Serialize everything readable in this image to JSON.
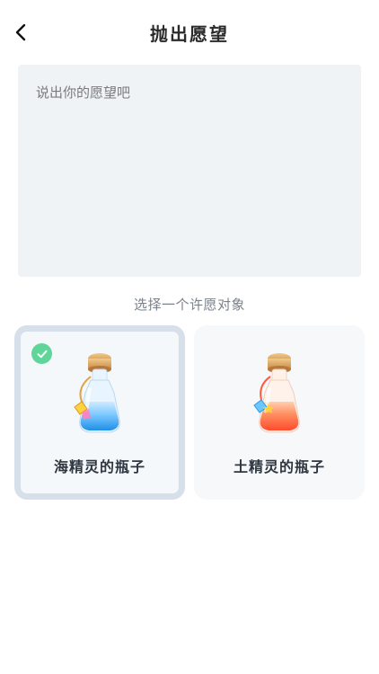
{
  "header": {
    "title": "抛出愿望"
  },
  "wish_input": {
    "placeholder": "说出你的愿望吧",
    "value": ""
  },
  "section_label": "选择一个许愿对象",
  "options": [
    {
      "label": "海精灵的瓶子",
      "selected": true,
      "icon": "blue-potion-bottle-icon",
      "liquid_color": "#3fb3ff"
    },
    {
      "label": "土精灵的瓶子",
      "selected": false,
      "icon": "orange-potion-bottle-icon",
      "liquid_color": "#ff6a3d"
    }
  ],
  "colors": {
    "selected_border": "#d7e0ea",
    "check_green": "#5fd59a",
    "input_bg": "#eff3f6"
  }
}
